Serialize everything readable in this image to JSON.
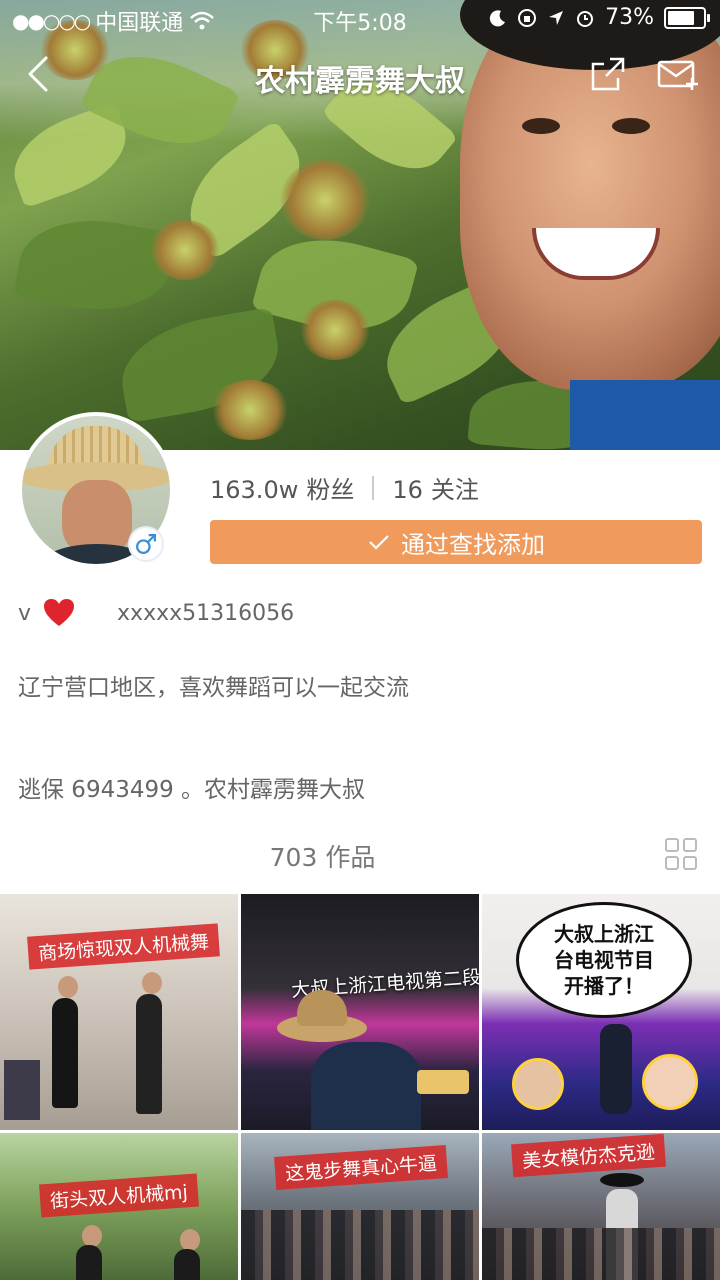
{
  "status_bar": {
    "carrier": "中国联通",
    "time": "下午5:08",
    "battery": "73%"
  },
  "nav": {
    "title": "农村霹雳舞大叔"
  },
  "profile": {
    "followers_count": "163.0w",
    "followers_label": "粉丝",
    "following_count": "16",
    "following_label": "关注",
    "add_button_label": "通过查找添加",
    "v_label": "v",
    "user_id": "xxxxx51316056",
    "bio_line1": "辽宁营口地区，喜欢舞蹈可以一起交流",
    "bio_line2": "逃保 6943499 。农村霹雳舞大叔"
  },
  "works": {
    "label": "703 作品"
  },
  "videos": [
    {
      "caption": "商场惊现双人机械舞"
    },
    {
      "caption": "大叔上浙江电视第二段"
    },
    {
      "caption_lines": [
        "大叔上浙江",
        "台电视节目",
        "开播了！"
      ]
    },
    {
      "caption": "街头双人机械mj"
    },
    {
      "caption": "这鬼步舞真心牛逼"
    },
    {
      "caption": "美女模仿杰克逊"
    }
  ],
  "colors": {
    "accent": "#f09a5c",
    "heart": "#e0242e",
    "male_icon": "#3a8fd6"
  }
}
